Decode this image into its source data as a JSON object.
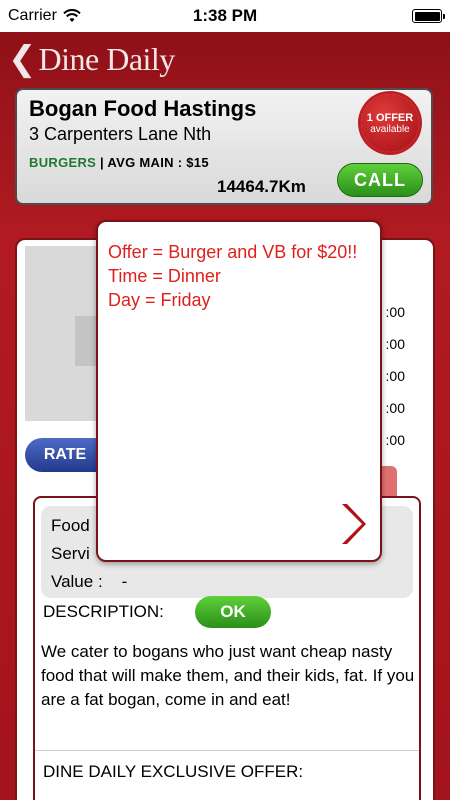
{
  "status_bar": {
    "carrier": "Carrier",
    "time": "1:38 PM"
  },
  "nav": {
    "title": "Dine Daily"
  },
  "restaurant": {
    "name": "Bogan Food Hastings",
    "address": "3 Carpenters Lane Nth",
    "category": "BURGERS",
    "meta_rest": " | AVG MAIN : $15",
    "distance": "14464.7Km",
    "offer_badge_line1": "1 OFFER",
    "offer_badge_line2": "available",
    "call_label": "CALL"
  },
  "hours": [
    ":00",
    ":00",
    ":00",
    ":00",
    ":00"
  ],
  "rate_label": "RATE",
  "ratings": {
    "food": "Food",
    "service": "Servi",
    "value": "Value :",
    "value_score": "-"
  },
  "description": {
    "label": "DESCRIPTION:",
    "ok_label": "OK",
    "text": "We cater to bogans who just want cheap nasty food that will make them, and their kids, fat. If you are a fat bogan, come in and eat!"
  },
  "exclusive_label": "DINE DAILY EXCLUSIVE OFFER:",
  "popup": {
    "offer_line": "Offer = Burger and VB for $20!!",
    "time_line": "Time = Dinner",
    "day_line": "Day = Friday"
  },
  "colors": {
    "accent_red": "#e0201c",
    "call_green": "#2a8f1a",
    "rate_blue": "#223a8c"
  }
}
